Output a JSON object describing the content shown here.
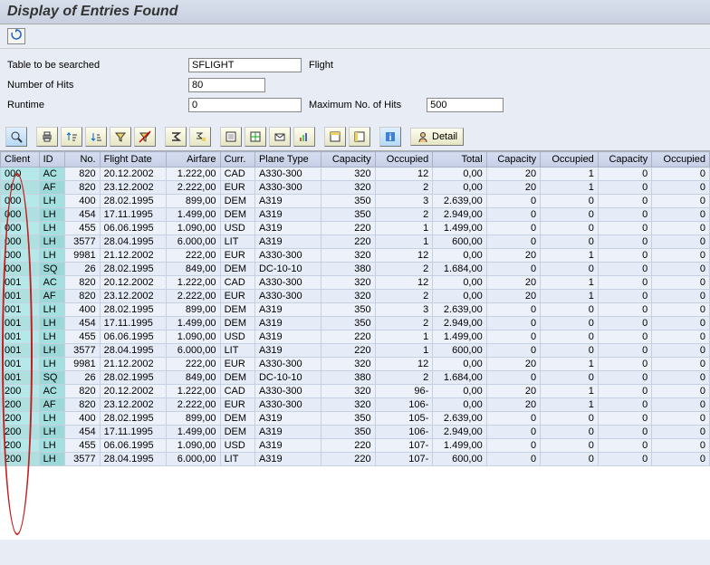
{
  "title": "Display of Entries Found",
  "form": {
    "table_label": "Table to be searched",
    "table_value": "SFLIGHT",
    "table_desc": "Flight",
    "hits_label": "Number of Hits",
    "hits_value": "80",
    "runtime_label": "Runtime",
    "runtime_value": "0",
    "max_label": "Maximum No. of Hits",
    "max_value": "500"
  },
  "toolbar": {
    "detail_label": "Detail"
  },
  "columns": [
    "Client",
    "ID",
    "No.",
    "Flight Date",
    "Airfare",
    "Curr.",
    "Plane Type",
    "Capacity",
    "Occupied",
    "Total",
    "Capacity",
    "Occupied",
    "Capacity",
    "Occupied"
  ],
  "rows": [
    [
      "000",
      "AC",
      "820",
      "20.12.2002",
      "1.222,00",
      "CAD",
      "A330-300",
      "320",
      "12",
      "0,00",
      "20",
      "1",
      "0",
      "0"
    ],
    [
      "000",
      "AF",
      "820",
      "23.12.2002",
      "2.222,00",
      "EUR",
      "A330-300",
      "320",
      "2",
      "0,00",
      "20",
      "1",
      "0",
      "0"
    ],
    [
      "000",
      "LH",
      "400",
      "28.02.1995",
      "899,00",
      "DEM",
      "A319",
      "350",
      "3",
      "2.639,00",
      "0",
      "0",
      "0",
      "0"
    ],
    [
      "000",
      "LH",
      "454",
      "17.11.1995",
      "1.499,00",
      "DEM",
      "A319",
      "350",
      "2",
      "2.949,00",
      "0",
      "0",
      "0",
      "0"
    ],
    [
      "000",
      "LH",
      "455",
      "06.06.1995",
      "1.090,00",
      "USD",
      "A319",
      "220",
      "1",
      "1.499,00",
      "0",
      "0",
      "0",
      "0"
    ],
    [
      "000",
      "LH",
      "3577",
      "28.04.1995",
      "6.000,00",
      "LIT",
      "A319",
      "220",
      "1",
      "600,00",
      "0",
      "0",
      "0",
      "0"
    ],
    [
      "000",
      "LH",
      "9981",
      "21.12.2002",
      "222,00",
      "EUR",
      "A330-300",
      "320",
      "12",
      "0,00",
      "20",
      "1",
      "0",
      "0"
    ],
    [
      "000",
      "SQ",
      "26",
      "28.02.1995",
      "849,00",
      "DEM",
      "DC-10-10",
      "380",
      "2",
      "1.684,00",
      "0",
      "0",
      "0",
      "0"
    ],
    [
      "001",
      "AC",
      "820",
      "20.12.2002",
      "1.222,00",
      "CAD",
      "A330-300",
      "320",
      "12",
      "0,00",
      "20",
      "1",
      "0",
      "0"
    ],
    [
      "001",
      "AF",
      "820",
      "23.12.2002",
      "2.222,00",
      "EUR",
      "A330-300",
      "320",
      "2",
      "0,00",
      "20",
      "1",
      "0",
      "0"
    ],
    [
      "001",
      "LH",
      "400",
      "28.02.1995",
      "899,00",
      "DEM",
      "A319",
      "350",
      "3",
      "2.639,00",
      "0",
      "0",
      "0",
      "0"
    ],
    [
      "001",
      "LH",
      "454",
      "17.11.1995",
      "1.499,00",
      "DEM",
      "A319",
      "350",
      "2",
      "2.949,00",
      "0",
      "0",
      "0",
      "0"
    ],
    [
      "001",
      "LH",
      "455",
      "06.06.1995",
      "1.090,00",
      "USD",
      "A319",
      "220",
      "1",
      "1.499,00",
      "0",
      "0",
      "0",
      "0"
    ],
    [
      "001",
      "LH",
      "3577",
      "28.04.1995",
      "6.000,00",
      "LIT",
      "A319",
      "220",
      "1",
      "600,00",
      "0",
      "0",
      "0",
      "0"
    ],
    [
      "001",
      "LH",
      "9981",
      "21.12.2002",
      "222,00",
      "EUR",
      "A330-300",
      "320",
      "12",
      "0,00",
      "20",
      "1",
      "0",
      "0"
    ],
    [
      "001",
      "SQ",
      "26",
      "28.02.1995",
      "849,00",
      "DEM",
      "DC-10-10",
      "380",
      "2",
      "1.684,00",
      "0",
      "0",
      "0",
      "0"
    ],
    [
      "200",
      "AC",
      "820",
      "20.12.2002",
      "1.222,00",
      "CAD",
      "A330-300",
      "320",
      "96-",
      "0,00",
      "20",
      "1",
      "0",
      "0"
    ],
    [
      "200",
      "AF",
      "820",
      "23.12.2002",
      "2.222,00",
      "EUR",
      "A330-300",
      "320",
      "106-",
      "0,00",
      "20",
      "1",
      "0",
      "0"
    ],
    [
      "200",
      "LH",
      "400",
      "28.02.1995",
      "899,00",
      "DEM",
      "A319",
      "350",
      "105-",
      "2.639,00",
      "0",
      "0",
      "0",
      "0"
    ],
    [
      "200",
      "LH",
      "454",
      "17.11.1995",
      "1.499,00",
      "DEM",
      "A319",
      "350",
      "106-",
      "2.949,00",
      "0",
      "0",
      "0",
      "0"
    ],
    [
      "200",
      "LH",
      "455",
      "06.06.1995",
      "1.090,00",
      "USD",
      "A319",
      "220",
      "107-",
      "1.499,00",
      "0",
      "0",
      "0",
      "0"
    ],
    [
      "200",
      "LH",
      "3577",
      "28.04.1995",
      "6.000,00",
      "LIT",
      "A319",
      "220",
      "107-",
      "600,00",
      "0",
      "0",
      "0",
      "0"
    ]
  ]
}
